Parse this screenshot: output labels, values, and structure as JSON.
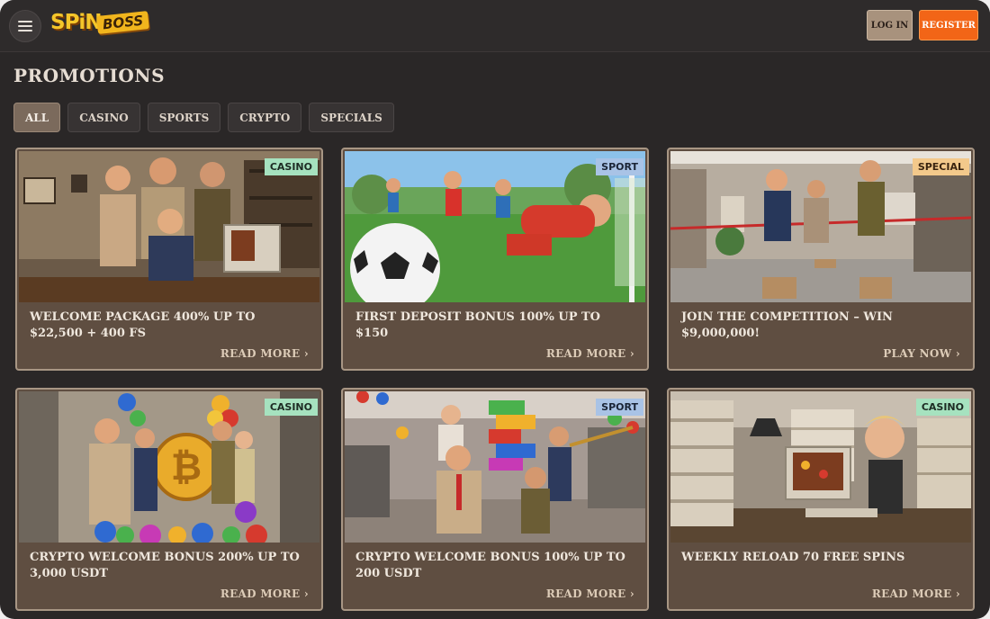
{
  "header": {
    "logo_main": "SPiN",
    "logo_accent": "BOSS",
    "login_label": "LOG IN",
    "register_label": "REGISTER"
  },
  "page": {
    "title": "PROMOTIONS"
  },
  "tabs": [
    {
      "label": "ALL",
      "active": true
    },
    {
      "label": "CASINO",
      "active": false
    },
    {
      "label": "SPORTS",
      "active": false
    },
    {
      "label": "CRYPTO",
      "active": false
    },
    {
      "label": "SPECIALS",
      "active": false
    }
  ],
  "promotions": [
    {
      "badge": "CASINO",
      "title": "WELCOME PACKAGE 400% UP TO $22,500 + 400 FS",
      "cta": "READ MORE"
    },
    {
      "badge": "SPORT",
      "title": "FIRST DEPOSIT BONUS 100% UP TO $150",
      "cta": "READ MORE"
    },
    {
      "badge": "SPECIAL",
      "title": "JOIN THE COMPETITION – WIN $9,000,000!",
      "cta": "PLAY NOW"
    },
    {
      "badge": "CASINO",
      "title": "CRYPTO WELCOME BONUS 200% UP TO 3,000 USDT",
      "cta": "READ MORE"
    },
    {
      "badge": "SPORT",
      "title": "CRYPTO WELCOME BONUS 100% UP TO 200 USDT",
      "cta": "READ MORE"
    },
    {
      "badge": "CASINO",
      "title": "WEEKLY RELOAD 70 FREE SPINS",
      "cta": "READ MORE"
    }
  ],
  "colors": {
    "background": "#2a2727",
    "card": "#5f4e41",
    "card_border": "#a89684",
    "register": "#f26517",
    "casino_badge": "#a6e2bf",
    "sport_badge": "#a9c3e6",
    "special_badge": "#f3c98b"
  },
  "icons": {
    "menu": "hamburger-icon",
    "cta_arrow": "chevron-right-icon"
  }
}
